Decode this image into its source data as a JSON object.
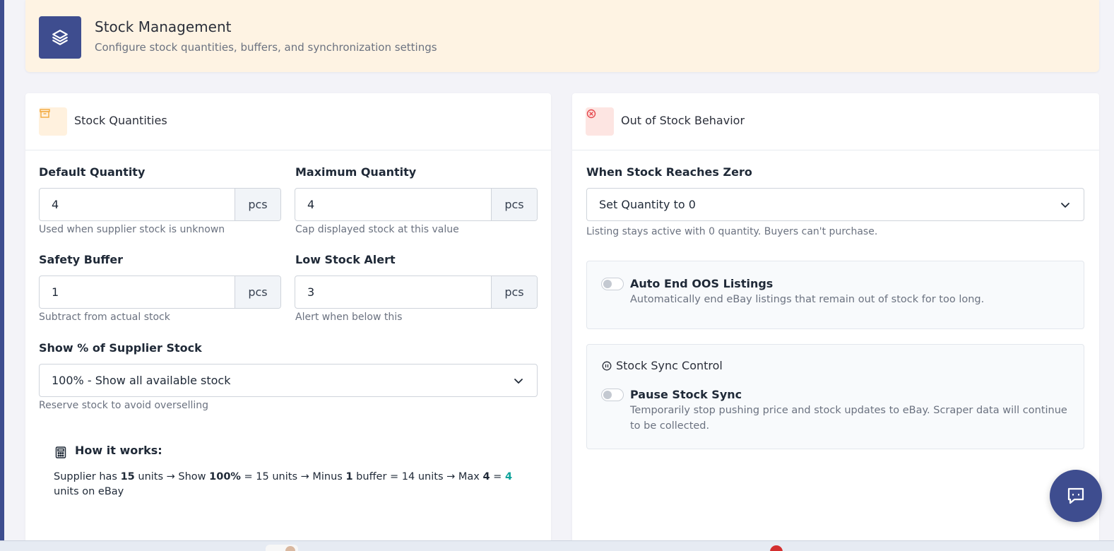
{
  "header": {
    "title": "Stock Management",
    "subtitle": "Configure stock quantities, buffers, and synchronization settings",
    "icon": "layers-icon"
  },
  "stock_quantities": {
    "title": "Stock Quantities",
    "icon": "archive-icon",
    "default_quantity": {
      "label": "Default Quantity",
      "value": "4",
      "unit": "pcs",
      "help": "Used when supplier stock is unknown"
    },
    "maximum_quantity": {
      "label": "Maximum Quantity",
      "value": "4",
      "unit": "pcs",
      "help": "Cap displayed stock at this value"
    },
    "safety_buffer": {
      "label": "Safety Buffer",
      "value": "1",
      "unit": "pcs",
      "help": "Subtract from actual stock"
    },
    "low_stock_alert": {
      "label": "Low Stock Alert",
      "value": "3",
      "unit": "pcs",
      "help": "Alert when below this"
    },
    "supplier_percent": {
      "label": "Show % of Supplier Stock",
      "value": "100% - Show all available stock",
      "help": "Reserve stock to avoid overselling"
    },
    "how_it_works": {
      "title": "How it works:",
      "icon": "calculator-icon",
      "t1": "Supplier has ",
      "supplier_units": "15",
      "t2": " units → Show ",
      "percent": "100%",
      "t3": " = 15 units → Minus ",
      "buffer": "1",
      "t4": " buffer = 14 units → Max ",
      "max": "4",
      "t5": " = ",
      "result": "4",
      "t6": " units on eBay"
    }
  },
  "out_of_stock": {
    "title": "Out of Stock Behavior",
    "icon": "x-circle-icon",
    "zero_action": {
      "label": "When Stock Reaches Zero",
      "value": "Set Quantity to 0",
      "help": "Listing stays active with 0 quantity. Buyers can't purchase."
    },
    "auto_end": {
      "title": "Auto End OOS Listings",
      "description": "Automatically end eBay listings that remain out of stock for too long.",
      "enabled": false
    },
    "sync_control": {
      "heading": "Stock Sync Control",
      "icon": "pause-circle-icon",
      "pause": {
        "title": "Pause Stock Sync",
        "description": "Temporarily stop pushing price and stock updates to eBay. Scraper data will continue to be collected.",
        "enabled": false
      }
    }
  },
  "chat": {
    "icon": "chat-icon"
  },
  "colors": {
    "brand": "#3e4d8f",
    "header_bg": "#fef3e3",
    "accent_teal": "#10a39b",
    "danger": "#e5484d",
    "amber": "#f2a93b"
  }
}
